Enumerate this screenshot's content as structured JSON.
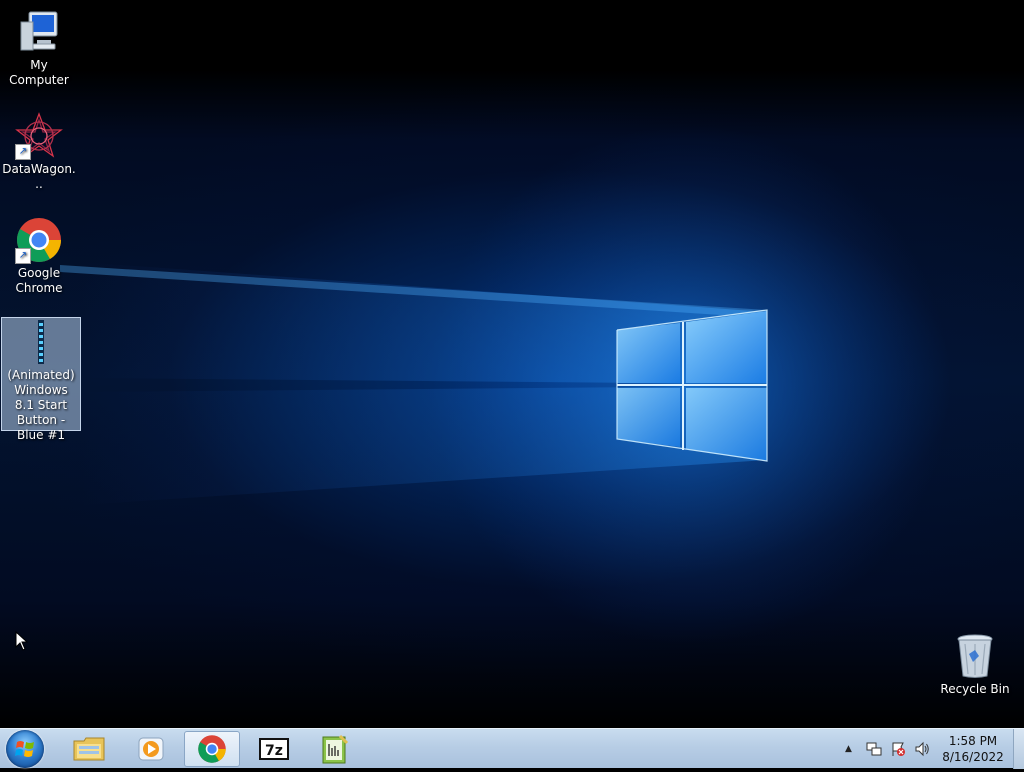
{
  "desktop": {
    "icons": [
      {
        "label": "My Computer",
        "icon": "computer-icon"
      },
      {
        "label": "DataWagon...",
        "icon": "datawagon-icon"
      },
      {
        "label": "Google Chrome",
        "icon": "chrome-icon"
      },
      {
        "label": "(Animated) Windows 8.1 Start Button - Blue #1",
        "icon": "start-button-file-icon"
      },
      {
        "label": "Recycle Bin",
        "icon": "recycle-bin-icon"
      }
    ]
  },
  "taskbar": {
    "start_icon": "windows-start-orb",
    "pinned": [
      {
        "name": "file-explorer",
        "icon": "folder-icon",
        "active": false
      },
      {
        "name": "media-player",
        "icon": "media-player-icon",
        "active": false
      },
      {
        "name": "google-chrome",
        "icon": "chrome-icon",
        "active": true
      },
      {
        "name": "7-zip",
        "icon": "7zip-icon",
        "label": "7z",
        "active": false
      },
      {
        "name": "notepad-plus",
        "icon": "notepad-icon",
        "active": false
      }
    ],
    "tray": {
      "icons": [
        "show-hidden-icons-arrow",
        "network-icon",
        "action-center-flag-icon",
        "volume-icon"
      ]
    },
    "clock": {
      "time": "1:58 PM",
      "date": "8/16/2022"
    }
  },
  "colors": {
    "taskbar": "#b7cde5",
    "wallpaper_glow": "#1a7fe6",
    "selection": "#b4cdeb"
  }
}
